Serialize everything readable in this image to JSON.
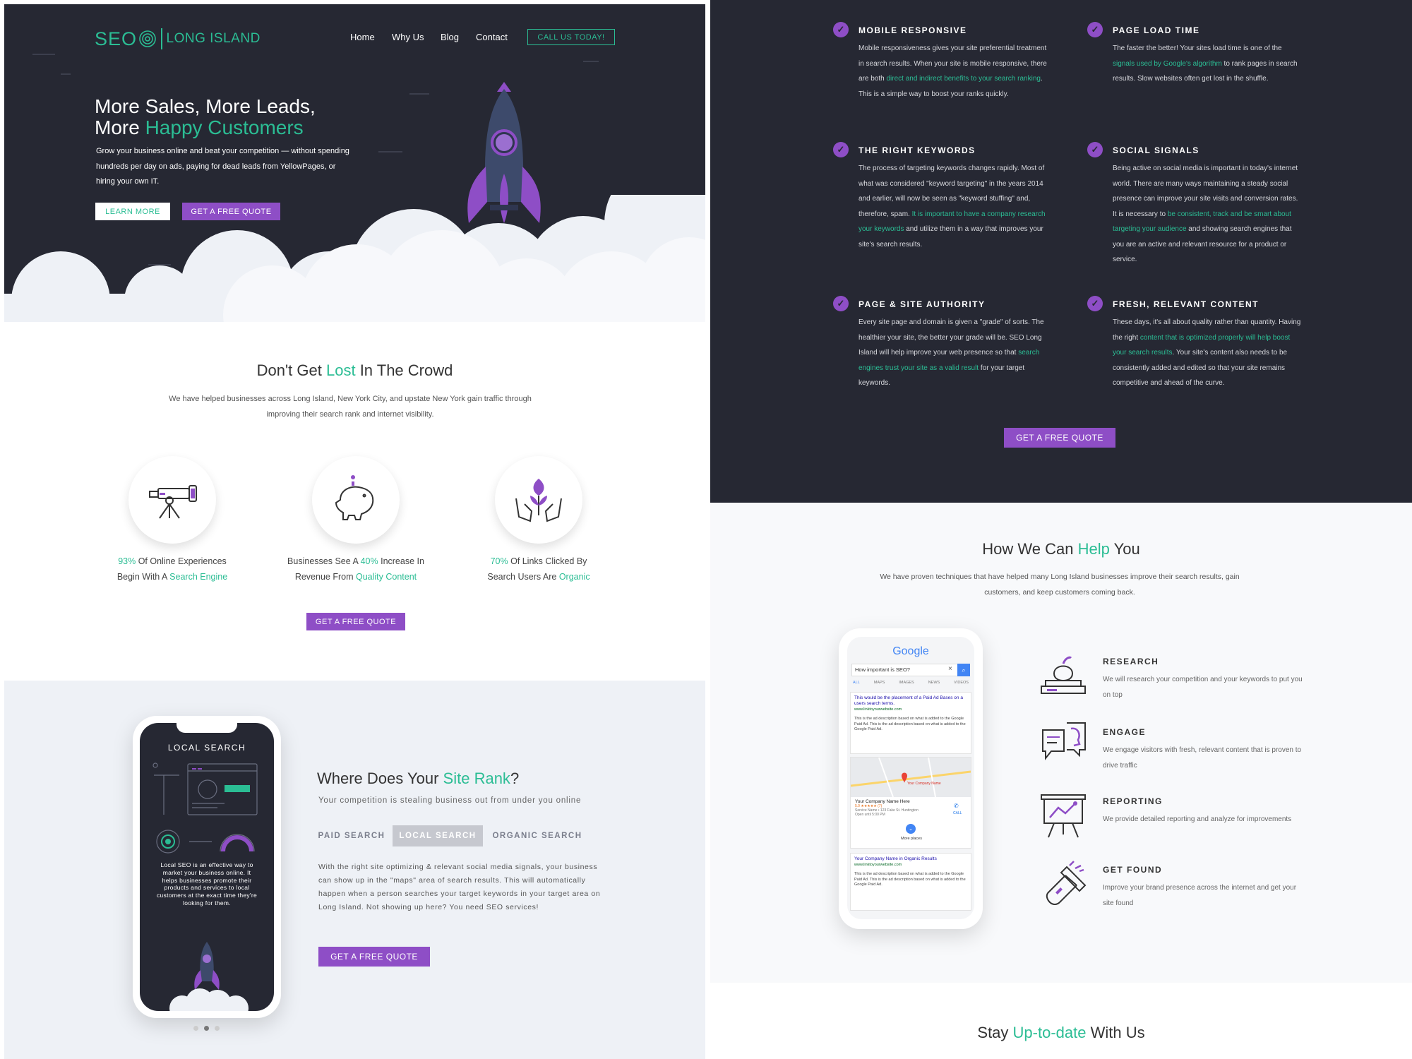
{
  "nav": {
    "logo_seo": "SEO",
    "logo_rest": "LONG ISLAND",
    "items": [
      "Home",
      "Why Us",
      "Blog",
      "Contact"
    ],
    "cta": "CALL US TODAY!"
  },
  "hero": {
    "title_line1": "More Sales, More Leads,",
    "title_line2_prefix": "More ",
    "title_line2_highlight": "Happy Customers",
    "paragraph": "Grow your business online and beat your competition — without spending hundreds per day on ads, paying for dead leads from YellowPages, or hiring your own IT.",
    "learn_more": "LEARN MORE",
    "quote": "GET A FREE QUOTE"
  },
  "crowd": {
    "title_prefix": "Don't Get ",
    "title_highlight": "Lost",
    "title_suffix": " In The Crowd",
    "paragraph": "We have helped businesses across Long Island, New York City, and upstate New York gain traffic through improving their search rank and internet visibility.",
    "stats": [
      {
        "icon": "telescope-icon",
        "a": "93%",
        "b": " Of Online Experiences",
        "c": "Begin With A ",
        "d": "Search Engine"
      },
      {
        "icon": "piggy-bank-icon",
        "a": "Businesses See A ",
        "b": "40%",
        "c": " Increase In",
        "d": "Revenue From ",
        "e": "Quality Content"
      },
      {
        "icon": "plant-hands-icon",
        "a": "70%",
        "b": " Of Links Clicked By",
        "c": "Search Users Are ",
        "d": "Organic"
      }
    ],
    "quote": "GET A FREE QUOTE"
  },
  "rank": {
    "phone_title": "LOCAL SEARCH",
    "phone_text": "Local SEO is an effective way to market your business online. It helps businesses promote their products and services to local customers at the exact time they're looking for them.",
    "title_prefix": "Where Does Your ",
    "title_highlight": "Site Rank",
    "title_suffix": "?",
    "subtitle": "Your competition is stealing business out from under you online",
    "tabs": [
      "PAID SEARCH",
      "LOCAL SEARCH",
      "ORGANIC SEARCH"
    ],
    "active_tab": "LOCAL SEARCH",
    "body": "With the right site optimizing & relevant social media signals, your business can show up in the \"maps\" area of search results. This will automatically happen when a person searches your target keywords in your target area on Long Island. Not showing up here? You need SEO services!",
    "quote": "GET A FREE QUOTE"
  },
  "features": {
    "items": [
      {
        "title": "MOBILE RESPONSIVE",
        "p1": "Mobile responsiveness gives your site preferential treatment in search results. When your site is mobile responsive, there are both ",
        "link": "direct and indirect benefits to your search ranking",
        "p2": ". This is a simple way to boost your ranks quickly."
      },
      {
        "title": "PAGE LOAD TIME",
        "p1": "The faster the better! Your sites load time is one of the ",
        "link": "signals used by Google's algorithm",
        "p2": " to rank pages in search results. Slow websites often get lost in the shuffle."
      },
      {
        "title": "THE RIGHT KEYWORDS",
        "p1": "The process of targeting keywords changes rapidly. Most of what was considered \"keyword targeting\" in the years 2014 and earlier, will now be seen as \"keyword stuffing\" and, therefore, spam. ",
        "link": "It is important to have a company research your keywords",
        "p2": " and utilize them in a way that improves your site's search results."
      },
      {
        "title": "SOCIAL SIGNALS",
        "p1": "Being active on social media is important in today's internet world. There are many ways maintaining a steady social presence can improve your site visits and conversion rates. It is necessary to ",
        "link": "be consistent, track and be smart about targeting your audience",
        "p2": " and showing search engines that you are an active and relevant resource for a product or service."
      },
      {
        "title": "PAGE & SITE AUTHORITY",
        "p1": "Every site page and domain is given a \"grade\" of sorts. The healthier your site, the better your grade will be. SEO Long Island will help improve your web presence so that ",
        "link": "search engines trust your site as a valid result",
        "p2": " for your target keywords."
      },
      {
        "title": "FRESH, RELEVANT CONTENT",
        "p1": "These days, it's all about quality rather than quantity. Having the right ",
        "link": "content that is optimized properly will help boost your search results",
        "p2": ". Your site's content also needs to be consistently added and edited so that your site remains competitive and ahead of the curve."
      }
    ],
    "quote": "GET A FREE QUOTE"
  },
  "how": {
    "title_prefix": "How We Can ",
    "title_highlight": "Help",
    "title_suffix": " You",
    "paragraph": "We have proven techniques that have helped many Long Island businesses improve their search results, gain customers, and keep customers coming back.",
    "items": [
      {
        "icon": "books-apple-icon",
        "title": "RESEARCH",
        "text": "We will research your competition and your keywords to put you on top"
      },
      {
        "icon": "chat-heads-icon",
        "title": "ENGAGE",
        "text": "We engage visitors with fresh, relevant content that is proven to drive traffic"
      },
      {
        "icon": "presentation-board-icon",
        "title": "REPORTING",
        "text": "We provide detailed reporting and analyze for improvements"
      },
      {
        "icon": "flashlight-icon",
        "title": "GET FOUND",
        "text": "Improve your brand presence across the internet and get your site found"
      }
    ],
    "phone": {
      "google": "Google",
      "query": "How important is SEO?",
      "tabs": [
        "ALL",
        "MAPS",
        "IMAGES",
        "NEWS",
        "VIDEOS"
      ],
      "ad_title": "This would be the placement of a Paid Ad Bases on a users search terms.",
      "ad_url": "www.linktoyourwebsite.com",
      "ad_desc": "This is the ad description based on what is added to the Google Paid Ad. This is the ad description based on what is added to the Google Paid Ad.",
      "map_label": "Your Company Name",
      "company": "Your Company Name Here",
      "rating": "5.0 ★★★★★ (7)",
      "address": "Service Name • 123 Fake St. Huntington",
      "hours": "Open until 5:00 PM",
      "call": "CALL",
      "more": "More places",
      "org_title": "Your Company Name in Organic Results",
      "org_url": "www.linktoyourwebsite.com",
      "org_desc": "This is the ad description based on what is added to the Google Paid Ad. This is the ad description based on what is added to the Google Paid Ad."
    }
  },
  "uptodate": {
    "prefix": "Stay ",
    "highlight": "Up-to-date",
    "suffix": " With Us"
  },
  "colors": {
    "dark": "#262833",
    "green": "#2bbd94",
    "purple": "#8e4ec6",
    "light": "#eef1f6"
  }
}
